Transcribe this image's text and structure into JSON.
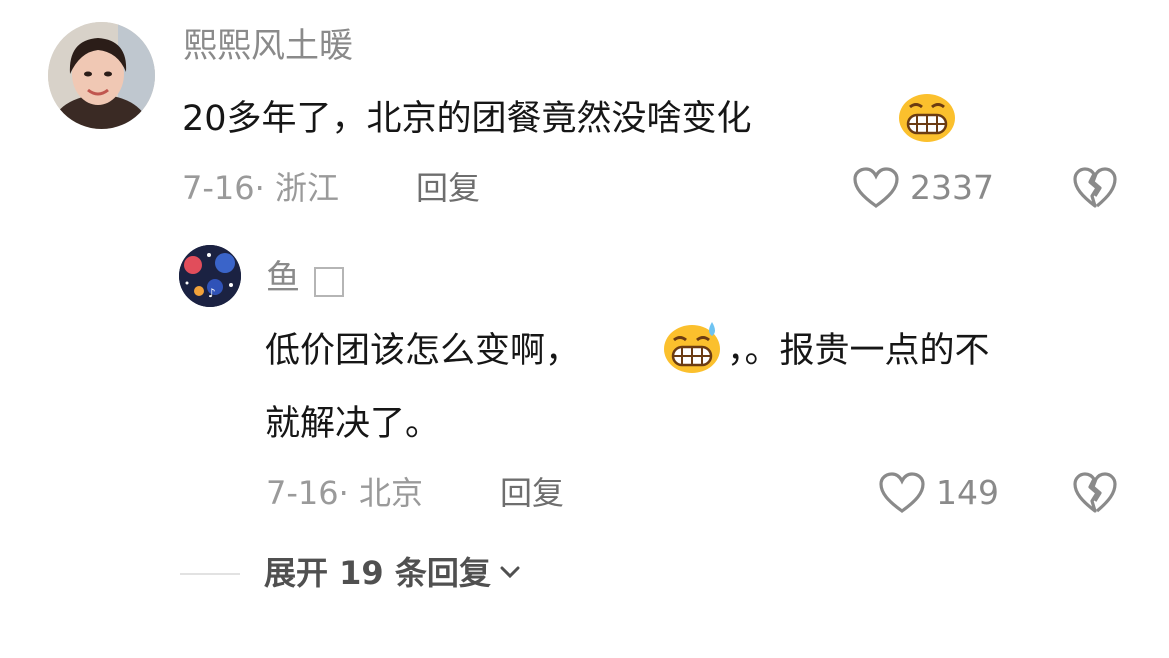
{
  "comment": {
    "username": "熙熙风土暖",
    "text": "20多年了，北京的团餐竟然没啥变化",
    "emoji": "grinning-face-emoji",
    "meta": "7-16· 浙江",
    "reply_label": "回复",
    "likes": "2337"
  },
  "reply": {
    "username": "鱼",
    "text_line1_a": "低价团该怎么变啊，",
    "emoji": "grinning-sweat-emoji",
    "text_line1_b": "，。报贵一点的不",
    "text_line2": "就解决了。",
    "meta": "7-16· 北京",
    "reply_label": "回复",
    "likes": "149"
  },
  "expand": {
    "label": "展开 19 条回复"
  },
  "colors": {
    "heart": "#8a8a8a",
    "emoji_face": "#fbc02d"
  }
}
